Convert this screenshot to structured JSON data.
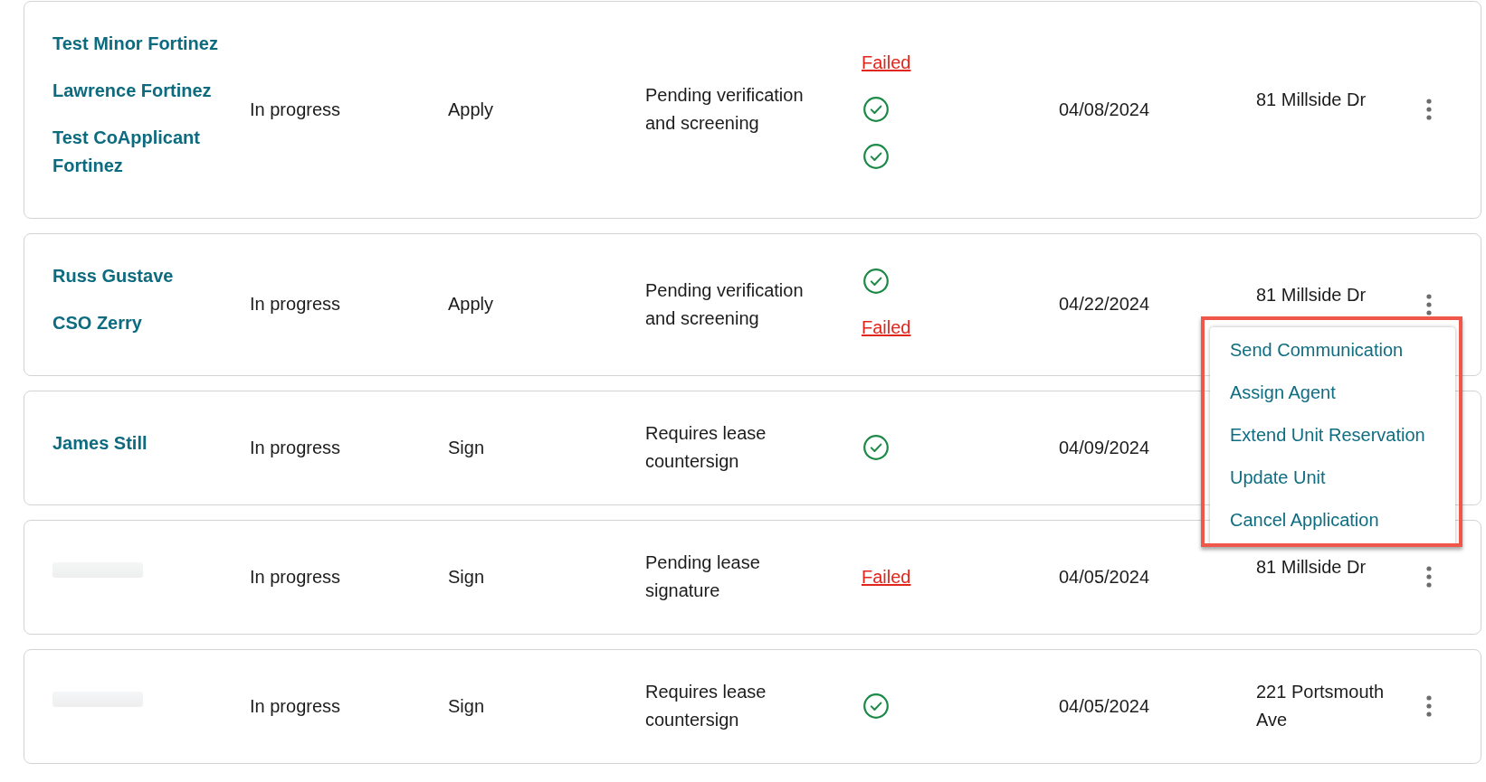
{
  "applications": [
    {
      "applicants": [
        {
          "kind": "name",
          "text": "Test Minor Fortinez"
        },
        {
          "kind": "name",
          "text": "Lawrence Fortinez"
        },
        {
          "kind": "name",
          "text": "Test CoApplicant Fortinez"
        }
      ],
      "status": "In progress",
      "step": "Apply",
      "description": "Pending verification and screening",
      "screenings": [
        {
          "kind": "failed",
          "label": "Failed"
        },
        {
          "kind": "passed"
        },
        {
          "kind": "passed"
        }
      ],
      "date": "04/08/2024",
      "address": "81 Millside Dr",
      "more_button": true
    },
    {
      "applicants": [
        {
          "kind": "name",
          "text": "Russ Gustave"
        },
        {
          "kind": "name",
          "text": "CSO Zerry"
        }
      ],
      "status": "In progress",
      "step": "Apply",
      "description": "Pending verification and screening",
      "screenings": [
        {
          "kind": "passed"
        },
        {
          "kind": "failed",
          "label": "Failed"
        }
      ],
      "date": "04/22/2024",
      "address": "81 Millside Dr",
      "more_button": true,
      "menu": {
        "highlighted": true,
        "items": [
          "Send Communication",
          "Assign Agent",
          "Extend Unit Reservation",
          "Update Unit",
          "Cancel Application"
        ]
      }
    },
    {
      "applicants": [
        {
          "kind": "name",
          "text": "James Still"
        }
      ],
      "status": "In progress",
      "step": "Sign",
      "description": "Requires lease countersign",
      "screenings": [
        {
          "kind": "passed"
        }
      ],
      "date": "04/09/2024",
      "more_button": false
    },
    {
      "applicants": [
        {
          "kind": "blurred"
        }
      ],
      "status": "In progress",
      "step": "Sign",
      "description": "Pending lease signature",
      "screenings": [
        {
          "kind": "failed",
          "label": "Failed"
        }
      ],
      "date": "04/05/2024",
      "address": "81 Millside Dr",
      "more_button": true
    },
    {
      "applicants": [
        {
          "kind": "blurred"
        }
      ],
      "status": "In progress",
      "step": "Sign",
      "description": "Requires lease countersign",
      "screenings": [
        {
          "kind": "passed"
        }
      ],
      "date": "04/05/2024",
      "address": "221 Portsmouth Ave",
      "more_button": true
    }
  ]
}
